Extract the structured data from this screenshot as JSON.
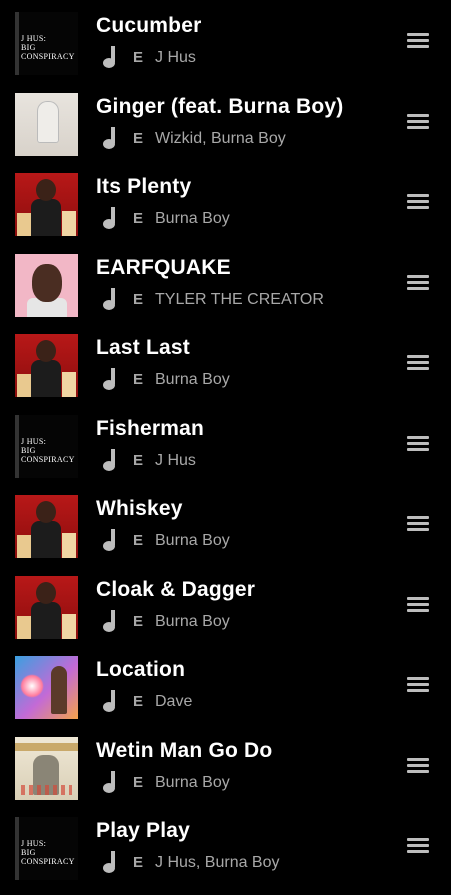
{
  "tracks": [
    {
      "title": "Cucumber",
      "explicit": "E",
      "artist": "J Hus",
      "art": "jhus"
    },
    {
      "title": "Ginger (feat. Burna Boy)",
      "explicit": "E",
      "artist": "Wizkid, Burna Boy",
      "art": "ginger"
    },
    {
      "title": "Its Plenty",
      "explicit": "E",
      "artist": "Burna Boy",
      "art": "burna"
    },
    {
      "title": "EARFQUAKE",
      "explicit": "E",
      "artist": "TYLER THE CREATOR",
      "art": "tyler"
    },
    {
      "title": "Last Last",
      "explicit": "E",
      "artist": "Burna Boy",
      "art": "burna"
    },
    {
      "title": "Fisherman",
      "explicit": "E",
      "artist": "J Hus",
      "art": "jhus"
    },
    {
      "title": "Whiskey",
      "explicit": "E",
      "artist": "Burna Boy",
      "art": "burna"
    },
    {
      "title": "Cloak & Dagger",
      "explicit": "E",
      "artist": "Burna Boy",
      "art": "burna"
    },
    {
      "title": "Location",
      "explicit": "E",
      "artist": "Dave",
      "art": "dave"
    },
    {
      "title": "Wetin Man Go Do",
      "explicit": "E",
      "artist": "Burna Boy",
      "art": "wetin"
    },
    {
      "title": "Play Play",
      "explicit": "E",
      "artist": "J Hus, Burna Boy",
      "art": "jhus"
    }
  ],
  "jhus_cover_text": "J HUS: BIG CONSPIRACY",
  "icons": {
    "note": "music-note-icon",
    "drag": "drag-handle-icon"
  },
  "colors": {
    "background": "#000000",
    "title": "#ffffff",
    "secondary": "#a8a8a8",
    "handle": "#bdbdbd"
  }
}
